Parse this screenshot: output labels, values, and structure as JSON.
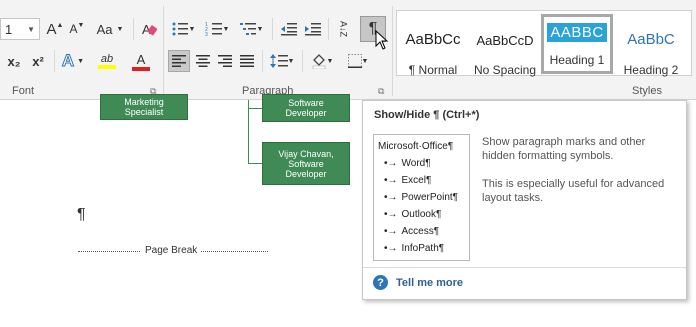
{
  "font": {
    "size_value": "1",
    "grow_glyph": "A",
    "shrink_glyph": "A",
    "case_label": "Aa",
    "subscript": "x₂",
    "superscript": "x²",
    "text_effects_glyph": "A",
    "highlight_glyph": "ab",
    "font_color_glyph": "A",
    "group_label": "Font"
  },
  "paragraph": {
    "sort_glyph": "A↓Z",
    "pilcrow": "¶",
    "group_label": "Paragraph"
  },
  "styles": {
    "group_label": "Styles",
    "items": [
      {
        "preview": "AaBbCс",
        "name": "¶ Normal"
      },
      {
        "preview": "AaBbCcD",
        "name": "No Spacing"
      },
      {
        "preview": "AABBC",
        "name": "Heading 1"
      },
      {
        "preview": "AaBbC",
        "name": "Heading 2"
      }
    ]
  },
  "document": {
    "box_left": "Marketing Specialist",
    "box_right_top": "Software Developer",
    "box_right_bottom": "Vijay Chavan, Software Developer",
    "pilcrow": "¶",
    "page_break": "Page Break"
  },
  "tooltip": {
    "title": "Show/Hide ¶ (Ctrl+*)",
    "preview_heading": "Microsoft·Office¶",
    "preview_items": [
      "Word¶",
      "Excel¶",
      "PowerPoint¶",
      "Outlook¶",
      "Access¶",
      "InfoPath¶"
    ],
    "bullet": "•→",
    "description_1": "Show paragraph marks and other hidden formatting symbols.",
    "description_2": "This is especially useful for advanced layout tasks.",
    "tell_me_more": "Tell me more",
    "help_glyph": "?"
  },
  "colors": {
    "accent_blue": "#2e75b6",
    "org_green": "#3f8a55",
    "heading1_fill": "#2aa3d8",
    "highlight_yellow": "#ffff00",
    "font_red": "#e02020"
  }
}
